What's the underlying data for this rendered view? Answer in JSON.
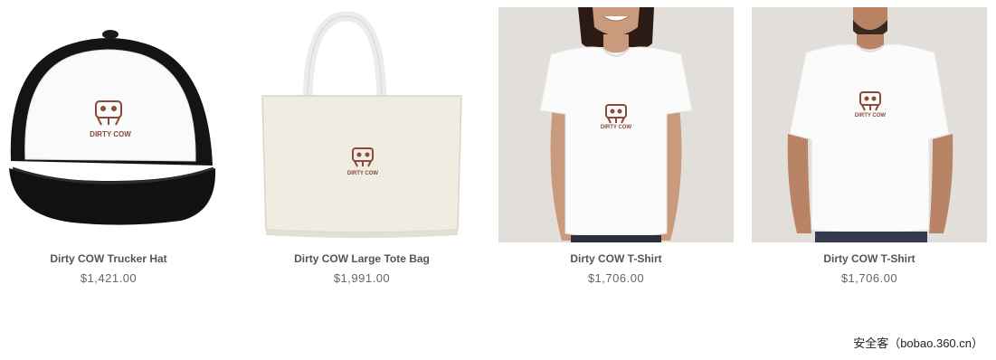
{
  "products": [
    {
      "title": "Dirty COW Trucker Hat",
      "price": "$1,421.00",
      "logo_text": "DIRTY COW"
    },
    {
      "title": "Dirty COW Large Tote Bag",
      "price": "$1,991.00",
      "logo_text": "DIRTY COW"
    },
    {
      "title": "Dirty COW T-Shirt",
      "price": "$1,706.00",
      "logo_text": "DIRTY COW"
    },
    {
      "title": "Dirty COW T-Shirt",
      "price": "$1,706.00",
      "logo_text": "DIRTY COW"
    }
  ],
  "watermark": "安全客（bobao.360.cn）",
  "colors": {
    "logo": "#8a4a3a",
    "photo_bg": "#e2dfdb",
    "title": "#555555",
    "price": "#666666"
  }
}
